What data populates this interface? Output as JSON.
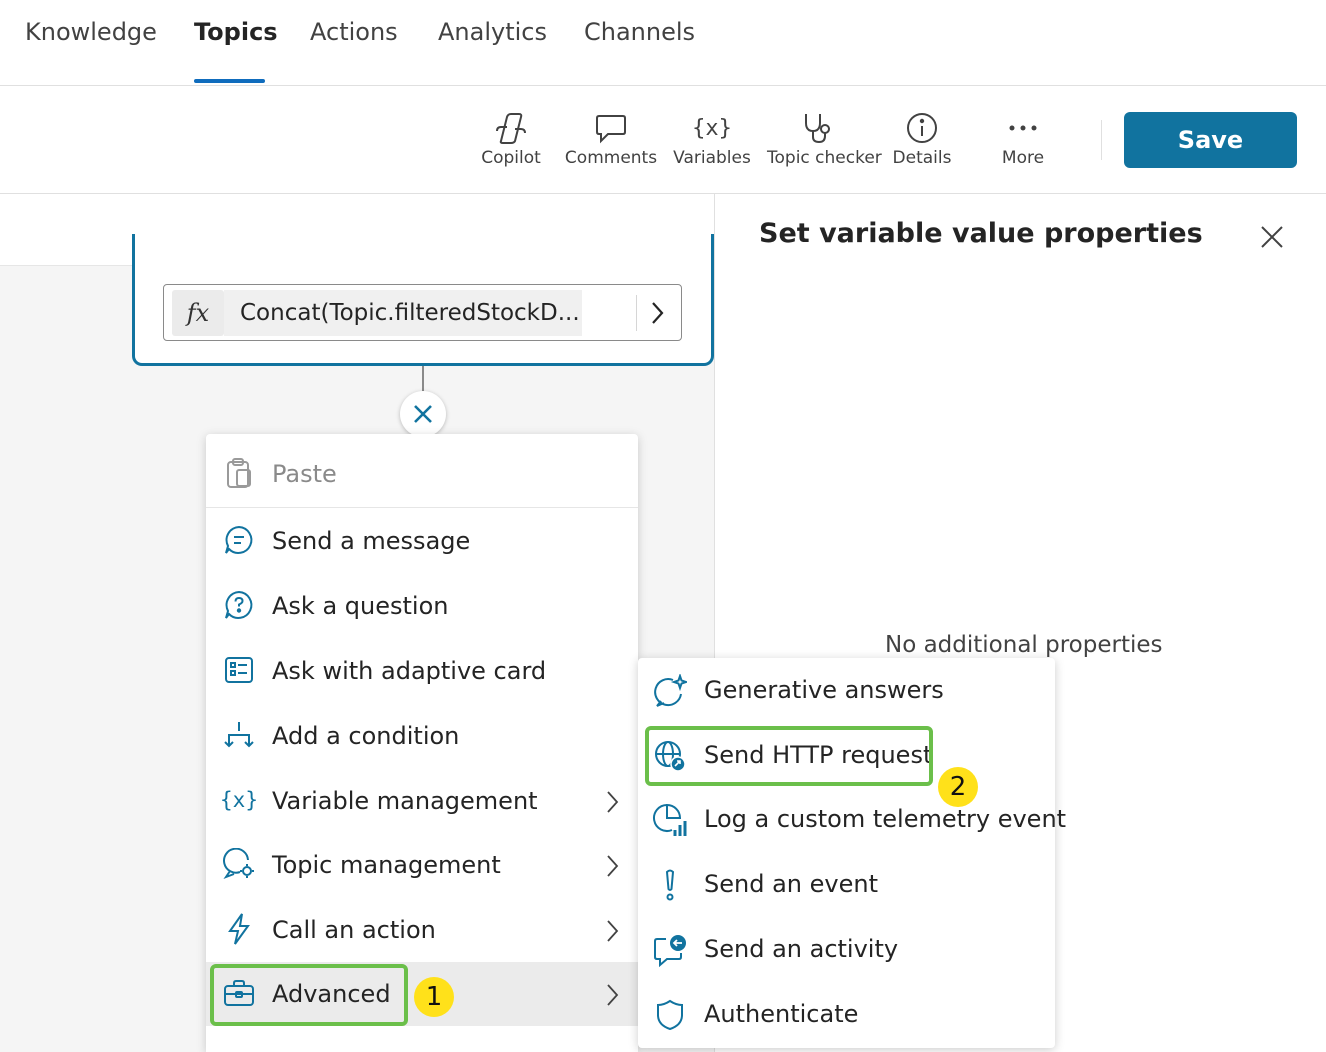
{
  "nav": {
    "tabs": [
      {
        "label": "Knowledge"
      },
      {
        "label": "Topics",
        "active": true
      },
      {
        "label": "Actions"
      },
      {
        "label": "Analytics"
      },
      {
        "label": "Channels"
      }
    ]
  },
  "toolbar": {
    "copilot": "Copilot",
    "comments": "Comments",
    "variables": "Variables",
    "variables_glyph": "{x}",
    "topic_checker": "Topic checker",
    "details": "Details",
    "more": "More",
    "save": "Save"
  },
  "canvas": {
    "fx_glyph": "fx",
    "formula": "Concat(Topic.filteredStockD..."
  },
  "panel": {
    "title": "Set variable value properties",
    "empty": "No additional properties"
  },
  "menu": {
    "paste": "Paste",
    "items": [
      {
        "label": "Send a message",
        "icon": "chat-message-icon"
      },
      {
        "label": "Ask a question",
        "icon": "chat-question-icon"
      },
      {
        "label": "Ask with adaptive card",
        "icon": "adaptive-card-icon"
      },
      {
        "label": "Add a condition",
        "icon": "branch-icon"
      },
      {
        "label": "Variable management",
        "icon": "variable-icon",
        "submenu": true
      },
      {
        "label": "Topic management",
        "icon": "topic-settings-icon",
        "submenu": true
      },
      {
        "label": "Call an action",
        "icon": "lightning-icon",
        "submenu": true
      },
      {
        "label": "Advanced",
        "icon": "briefcase-icon",
        "submenu": true
      }
    ]
  },
  "submenu": {
    "items": [
      {
        "label": "Generative answers",
        "icon": "sparkle-chat-icon"
      },
      {
        "label": "Send HTTP request",
        "icon": "globe-arrow-icon"
      },
      {
        "label": "Log a custom telemetry event",
        "icon": "chart-telemetry-icon"
      },
      {
        "label": "Send an event",
        "icon": "exclamation-icon"
      },
      {
        "label": "Send an activity",
        "icon": "chat-arrow-icon"
      },
      {
        "label": "Authenticate",
        "icon": "shield-icon"
      }
    ]
  },
  "callouts": {
    "one": "1",
    "two": "2"
  },
  "colors": {
    "accent": "#11739f",
    "tab_underline": "#0f6cbd",
    "highlight": "#6bbf4a",
    "callout": "#ffe11a"
  }
}
